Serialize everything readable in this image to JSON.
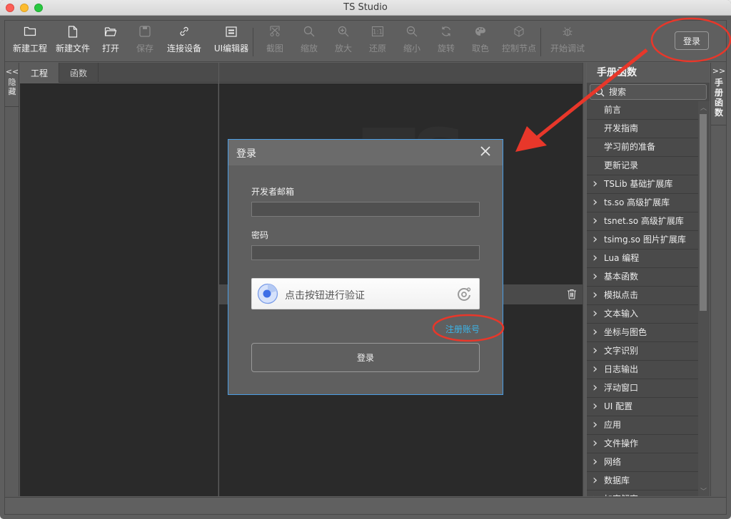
{
  "window": {
    "title": "TS Studio"
  },
  "toolbar": {
    "buttons": [
      {
        "label": "新建工程",
        "icon": "folder-icon",
        "enabled": true
      },
      {
        "label": "新建文件",
        "icon": "file-icon",
        "enabled": true
      },
      {
        "label": "打开",
        "icon": "open-folder-icon",
        "enabled": true
      },
      {
        "label": "保存",
        "icon": "save-icon",
        "enabled": false
      },
      {
        "label": "连接设备",
        "icon": "link-icon",
        "enabled": true
      },
      {
        "label": "UI编辑器",
        "icon": "ui-editor-icon",
        "enabled": true
      },
      {
        "label": "截图",
        "icon": "screenshot-icon",
        "enabled": false
      },
      {
        "label": "缩放",
        "icon": "zoom-icon",
        "enabled": false
      },
      {
        "label": "放大",
        "icon": "zoom-in-icon",
        "enabled": false
      },
      {
        "label": "还原",
        "icon": "actual-size-icon",
        "enabled": false
      },
      {
        "label": "缩小",
        "icon": "zoom-out-icon",
        "enabled": false
      },
      {
        "label": "旋转",
        "icon": "rotate-icon",
        "enabled": false
      },
      {
        "label": "取色",
        "icon": "palette-icon",
        "enabled": false
      },
      {
        "label": "控制节点",
        "icon": "cube-icon",
        "enabled": false
      },
      {
        "label": "开始调试",
        "icon": "bug-icon",
        "enabled": false
      }
    ],
    "login_label": "登录"
  },
  "left_strip": {
    "arrow": "<<",
    "label": "隐藏"
  },
  "project_panel": {
    "tabs": [
      {
        "label": "工程",
        "active": true
      },
      {
        "label": "函数",
        "active": false
      }
    ]
  },
  "editor": {
    "watermark": "TS"
  },
  "manual": {
    "title": "手册函数",
    "search_placeholder": "搜索",
    "items": [
      {
        "label": "前言",
        "expandable": false
      },
      {
        "label": "开发指南",
        "expandable": false
      },
      {
        "label": "学习前的准备",
        "expandable": false
      },
      {
        "label": "更新记录",
        "expandable": false
      },
      {
        "label": "TSLib 基础扩展库",
        "expandable": true
      },
      {
        "label": "ts.so 高级扩展库",
        "expandable": true
      },
      {
        "label": "tsnet.so 高级扩展库",
        "expandable": true
      },
      {
        "label": "tsimg.so 图片扩展库",
        "expandable": true
      },
      {
        "label": "Lua 编程",
        "expandable": true
      },
      {
        "label": "基本函数",
        "expandable": true
      },
      {
        "label": "模拟点击",
        "expandable": true
      },
      {
        "label": "文本输入",
        "expandable": true
      },
      {
        "label": "坐标与图色",
        "expandable": true
      },
      {
        "label": "文字识别",
        "expandable": true
      },
      {
        "label": "日志输出",
        "expandable": true
      },
      {
        "label": "浮动窗口",
        "expandable": true
      },
      {
        "label": "UI 配置",
        "expandable": true
      },
      {
        "label": "应用",
        "expandable": true
      },
      {
        "label": "文件操作",
        "expandable": true
      },
      {
        "label": "网络",
        "expandable": true
      },
      {
        "label": "数据库",
        "expandable": true
      },
      {
        "label": "加密解密",
        "expandable": true
      }
    ]
  },
  "right_strip": {
    "arrow": ">>",
    "label": "手册函数"
  },
  "login_dialog": {
    "title": "登录",
    "email_label": "开发者邮箱",
    "email_value": "",
    "password_label": "密码",
    "password_value": "",
    "captcha_text": "点击按钮进行验证",
    "register_link": "注册账号",
    "submit_label": "登录"
  },
  "colors": {
    "accent_blue": "#4a9ee6",
    "link": "#3cb4e8",
    "annotation_red": "#e8372a"
  }
}
